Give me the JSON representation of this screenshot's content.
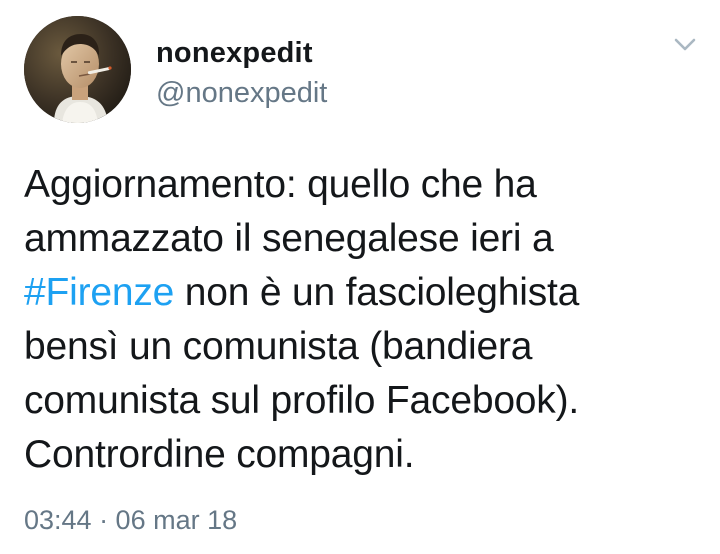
{
  "user": {
    "display_name": "nonexpedit",
    "handle": "@nonexpedit"
  },
  "tweet": {
    "line1": "Aggiornamento: quello che ha",
    "line2": "ammazzato il senegalese ieri a",
    "hashtag": "#Firenze",
    "line3_rest": " non è un fascioleghista",
    "line4": "bensì un comunista (bandiera",
    "line5": "comunista sul profilo Facebook).",
    "line6": "Contrordine compagni.",
    "timestamp": "03:44 · 06 mar 18"
  },
  "icons": {
    "avatar": "profile-photo",
    "menu": "chevron-down-icon"
  },
  "colors": {
    "text": "#14171a",
    "secondary": "#657786",
    "link": "#1da1f2"
  }
}
